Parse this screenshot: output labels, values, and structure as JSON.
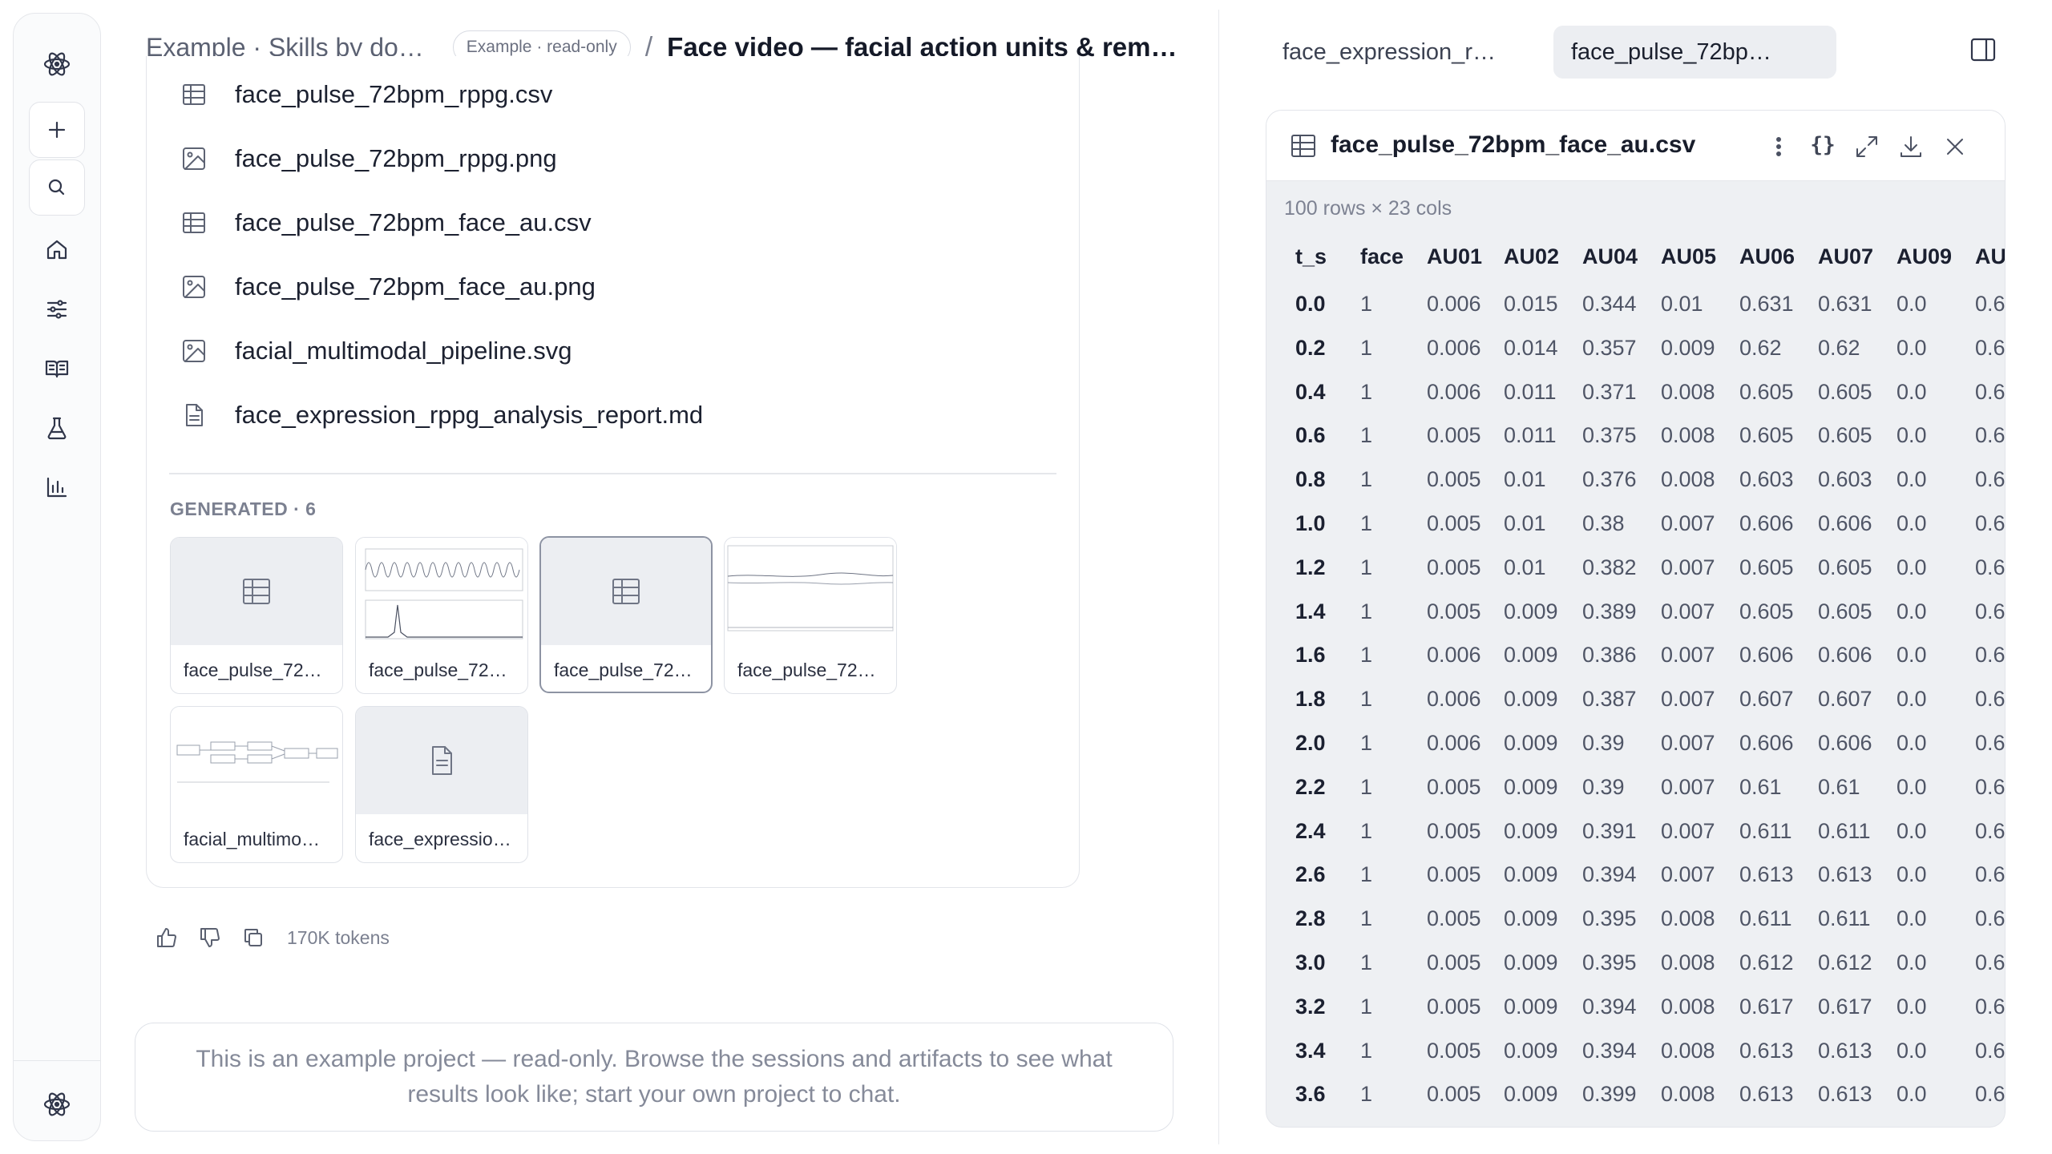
{
  "header": {
    "breadcrumb": "Example · Skills by do…",
    "badge": "Example · read-only",
    "separator": "/",
    "title": "Face video — facial action units & rem…"
  },
  "files": [
    {
      "name": "face_pulse_72bpm_rppg.csv",
      "icon": "table-icon"
    },
    {
      "name": "face_pulse_72bpm_rppg.png",
      "icon": "image-icon"
    },
    {
      "name": "face_pulse_72bpm_face_au.csv",
      "icon": "table-icon"
    },
    {
      "name": "face_pulse_72bpm_face_au.png",
      "icon": "image-icon"
    },
    {
      "name": "facial_multimodal_pipeline.svg",
      "icon": "image-icon"
    },
    {
      "name": "face_expression_rppg_analysis_report.md",
      "icon": "document-icon"
    }
  ],
  "generated": {
    "label": "GENERATED · 6",
    "items": [
      {
        "name": "face_pulse_72…",
        "kind": "table"
      },
      {
        "name": "face_pulse_72…",
        "kind": "plot"
      },
      {
        "name": "face_pulse_72…",
        "kind": "table",
        "selected": true
      },
      {
        "name": "face_pulse_72…",
        "kind": "plot"
      },
      {
        "name": "facial_multimo…",
        "kind": "diagram"
      },
      {
        "name": "face_expressio…",
        "kind": "document"
      }
    ]
  },
  "actions": {
    "tokens": "170K tokens"
  },
  "notice": "This is an example project — read-only. Browse the sessions and artifacts to see what results look like; start your own project to chat.",
  "tabs": [
    {
      "label": "face_expression_r…",
      "active": false
    },
    {
      "label": "face_pulse_72bp…",
      "active": true
    }
  ],
  "viewer": {
    "title": "face_pulse_72bpm_face_au.csv",
    "dims": "100 rows × 23 cols",
    "braces": "{}",
    "columns": [
      "t_s",
      "face",
      "AU01",
      "AU02",
      "AU04",
      "AU05",
      "AU06",
      "AU07",
      "AU09",
      "AU"
    ],
    "rows": [
      [
        "0.0",
        "1",
        "0.006",
        "0.015",
        "0.344",
        "0.01",
        "0.631",
        "0.631",
        "0.0",
        "0.6"
      ],
      [
        "0.2",
        "1",
        "0.006",
        "0.014",
        "0.357",
        "0.009",
        "0.62",
        "0.62",
        "0.0",
        "0.6"
      ],
      [
        "0.4",
        "1",
        "0.006",
        "0.011",
        "0.371",
        "0.008",
        "0.605",
        "0.605",
        "0.0",
        "0.6"
      ],
      [
        "0.6",
        "1",
        "0.005",
        "0.011",
        "0.375",
        "0.008",
        "0.605",
        "0.605",
        "0.0",
        "0.6"
      ],
      [
        "0.8",
        "1",
        "0.005",
        "0.01",
        "0.376",
        "0.008",
        "0.603",
        "0.603",
        "0.0",
        "0.6"
      ],
      [
        "1.0",
        "1",
        "0.005",
        "0.01",
        "0.38",
        "0.007",
        "0.606",
        "0.606",
        "0.0",
        "0.6"
      ],
      [
        "1.2",
        "1",
        "0.005",
        "0.01",
        "0.382",
        "0.007",
        "0.605",
        "0.605",
        "0.0",
        "0.6"
      ],
      [
        "1.4",
        "1",
        "0.005",
        "0.009",
        "0.389",
        "0.007",
        "0.605",
        "0.605",
        "0.0",
        "0.6"
      ],
      [
        "1.6",
        "1",
        "0.006",
        "0.009",
        "0.386",
        "0.007",
        "0.606",
        "0.606",
        "0.0",
        "0.6"
      ],
      [
        "1.8",
        "1",
        "0.006",
        "0.009",
        "0.387",
        "0.007",
        "0.607",
        "0.607",
        "0.0",
        "0.6"
      ],
      [
        "2.0",
        "1",
        "0.006",
        "0.009",
        "0.39",
        "0.007",
        "0.606",
        "0.606",
        "0.0",
        "0.6"
      ],
      [
        "2.2",
        "1",
        "0.005",
        "0.009",
        "0.39",
        "0.007",
        "0.61",
        "0.61",
        "0.0",
        "0.6"
      ],
      [
        "2.4",
        "1",
        "0.005",
        "0.009",
        "0.391",
        "0.007",
        "0.611",
        "0.611",
        "0.0",
        "0.6"
      ],
      [
        "2.6",
        "1",
        "0.005",
        "0.009",
        "0.394",
        "0.007",
        "0.613",
        "0.613",
        "0.0",
        "0.6"
      ],
      [
        "2.8",
        "1",
        "0.005",
        "0.009",
        "0.395",
        "0.008",
        "0.611",
        "0.611",
        "0.0",
        "0.6"
      ],
      [
        "3.0",
        "1",
        "0.005",
        "0.009",
        "0.395",
        "0.008",
        "0.612",
        "0.612",
        "0.0",
        "0.6"
      ],
      [
        "3.2",
        "1",
        "0.005",
        "0.009",
        "0.394",
        "0.008",
        "0.617",
        "0.617",
        "0.0",
        "0.6"
      ],
      [
        "3.4",
        "1",
        "0.005",
        "0.009",
        "0.394",
        "0.008",
        "0.613",
        "0.613",
        "0.0",
        "0.6"
      ],
      [
        "3.6",
        "1",
        "0.005",
        "0.009",
        "0.399",
        "0.008",
        "0.613",
        "0.613",
        "0.0",
        "0.6"
      ]
    ]
  },
  "rail": {
    "items": [
      "atom-logo-icon",
      "plus-icon",
      "search-icon",
      "home-icon",
      "sliders-icon",
      "book-icon",
      "flask-icon",
      "bar-chart-icon",
      "atom-footer-icon"
    ]
  },
  "colors": {
    "selected_tab_bg": "#eceef2",
    "table_bg": "#eef0f3",
    "text": "#1e2230"
  }
}
